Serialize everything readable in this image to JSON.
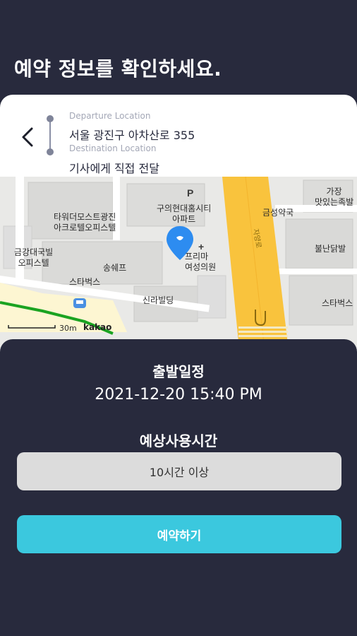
{
  "page": {
    "title": "예약 정보를 확인하세요."
  },
  "route": {
    "departure_label": "Departure Location",
    "departure_value": "서울 광진구 아차산로 355",
    "destination_label": "Destination Location",
    "destination_value": "기사에게 직접 전달"
  },
  "map": {
    "labels": {
      "building1": "타워더모스트광진",
      "building1b": "아크로텔오피스텔",
      "officetel": "금강대국빌",
      "officetel_b": "오피스텔",
      "apartment": "구의현대홈시티",
      "apartment_b": "아파트",
      "hospital": "프리마",
      "hospital_b": "여성의원",
      "chef": "송쉐프",
      "starbucks1": "스타벅스",
      "silla": "신라빌딩",
      "pharmacy": "금성약국",
      "store": "가장",
      "store_b": "맛있는족발",
      "bulldak": "불난닭발",
      "starbucks2": "스타벅스",
      "road": "자양로",
      "scale": "30m",
      "brand": "kakao",
      "parking": "P"
    },
    "colors": {
      "road": "#f9c33d",
      "building": "#d7d7d5",
      "pin": "#2d8cf0"
    }
  },
  "schedule": {
    "departure_title": "출발일정",
    "departure_value": "2021-12-20 15:40 PM",
    "duration_title": "예상사용시간",
    "duration_value": "10시간 이상"
  },
  "actions": {
    "reserve_label": "예약하기"
  },
  "colors": {
    "background": "#282a3d",
    "accent": "#3bc8de",
    "select_bg": "#dcdcdc"
  }
}
